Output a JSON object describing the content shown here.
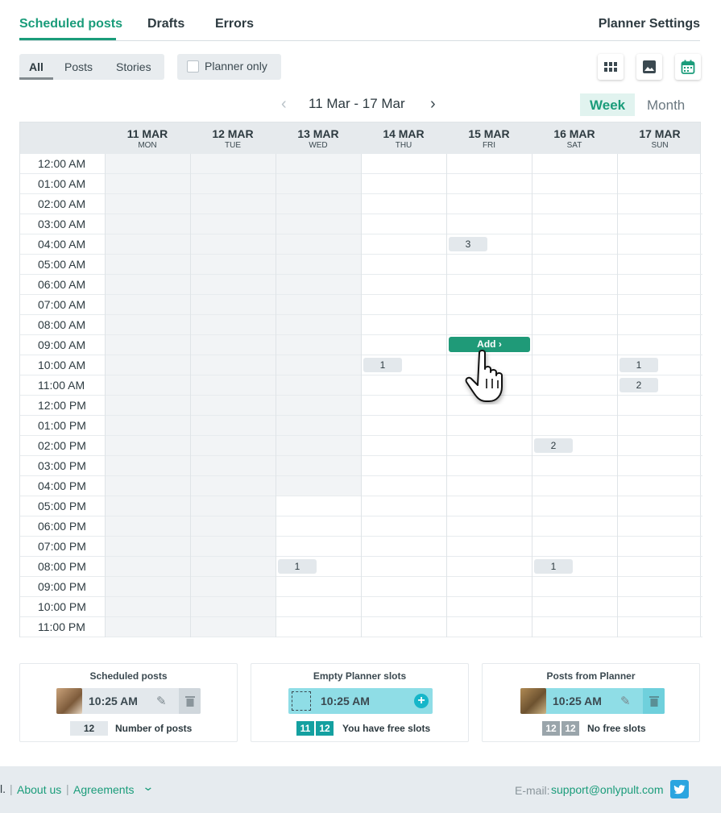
{
  "tabs": {
    "scheduled": "Scheduled posts",
    "drafts": "Drafts",
    "errors": "Errors",
    "settings": "Planner Settings"
  },
  "filters": {
    "all": "All",
    "posts": "Posts",
    "stories": "Stories",
    "planner_only": "Planner only"
  },
  "view_icons": [
    "grid-view-icon",
    "image-view-icon",
    "calendar-view-icon"
  ],
  "week": {
    "range": "11 Mar - 17 Mar",
    "week_label": "Week",
    "month_label": "Month"
  },
  "days": [
    {
      "date": "11 MAR",
      "dow": "MON"
    },
    {
      "date": "12 MAR",
      "dow": "TUE"
    },
    {
      "date": "13 MAR",
      "dow": "WED"
    },
    {
      "date": "14 MAR",
      "dow": "THU"
    },
    {
      "date": "15 MAR",
      "dow": "FRI"
    },
    {
      "date": "16 MAR",
      "dow": "SAT"
    },
    {
      "date": "17 MAR",
      "dow": "SUN"
    }
  ],
  "times": [
    "12:00 AM",
    "01:00 AM",
    "02:00 AM",
    "03:00 AM",
    "04:00 AM",
    "05:00 AM",
    "06:00 AM",
    "07:00 AM",
    "08:00 AM",
    "09:00 AM",
    "10:00 AM",
    "11:00 AM",
    "12:00 PM",
    "01:00 PM",
    "02:00 PM",
    "03:00 PM",
    "04:00 PM",
    "05:00 PM",
    "06:00 PM",
    "07:00 PM",
    "08:00 PM",
    "09:00 PM",
    "10:00 PM",
    "11:00 PM"
  ],
  "events": [
    {
      "day": 4,
      "hour": 4,
      "count": "3"
    },
    {
      "day": 3,
      "hour": 10,
      "count": "1"
    },
    {
      "day": 6,
      "hour": 10,
      "count": "1"
    },
    {
      "day": 6,
      "hour": 11,
      "count": "2"
    },
    {
      "day": 5,
      "hour": 14,
      "count": "2"
    },
    {
      "day": 2,
      "hour": 20,
      "count": "1"
    },
    {
      "day": 5,
      "hour": 20,
      "count": "1"
    }
  ],
  "add_button": {
    "label": "Add",
    "day": 4,
    "hour": 9
  },
  "legend": {
    "scheduled": {
      "title": "Scheduled posts",
      "time": "10:25 AM",
      "count": "12",
      "note": "Number of posts"
    },
    "empty": {
      "title": "Empty Planner slots",
      "time": "10:25 AM",
      "n1": "11",
      "n2": "12",
      "note": "You have free slots"
    },
    "from_planner": {
      "title": "Posts from Planner",
      "time": "10:25 AM",
      "n1": "12",
      "n2": "12",
      "note": "No free slots"
    }
  },
  "footer": {
    "edge": "l.",
    "about": "About us",
    "agreements": "Agreements",
    "email_label": "E-mail:",
    "email": "support@onlypult.com"
  },
  "colors": {
    "accent": "#1a9c7a",
    "cyan": "#8fdde6",
    "past": "#f2f4f6"
  }
}
